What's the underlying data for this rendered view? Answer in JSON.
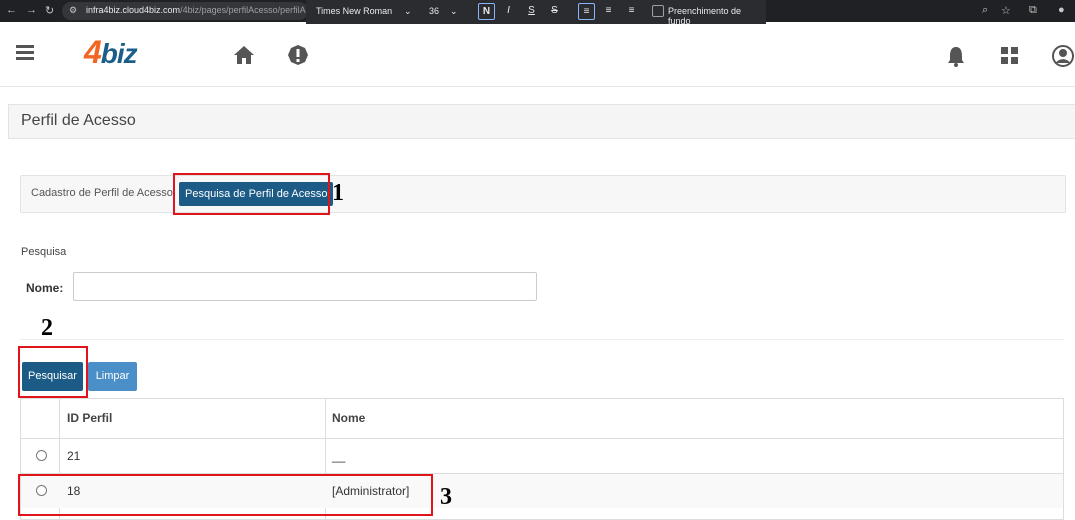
{
  "browser": {
    "url_host": "infra4biz.cloud4biz.com",
    "url_path": "/4biz/pages/perfilAcesso/perfilAcesso...",
    "format_toolbar": {
      "font": "Times New Roman",
      "size": "36",
      "bold": "N",
      "italic": "I",
      "underline": "S",
      "strike": "S",
      "background_fill_label": "Preenchimento de fundo"
    }
  },
  "app": {
    "logo_digit": "4",
    "logo_text": "biz"
  },
  "page": {
    "title": "Perfil de Acesso"
  },
  "tabs": {
    "cadastro": "Cadastro de Perfil de Acesso",
    "pesquisa": "Pesquisa de Perfil de Acesso"
  },
  "search": {
    "section_label": "Pesquisa",
    "nome_label": "Nome:",
    "nome_value": "",
    "pesquisar_label": "Pesquisar",
    "limpar_label": "Limpar"
  },
  "table": {
    "headers": [
      "ID Perfil",
      "Nome"
    ],
    "rows": [
      {
        "id": "21",
        "nome": "__"
      },
      {
        "id": "18",
        "nome": "[Administrator]"
      }
    ]
  },
  "annotations": [
    "1",
    "2",
    "3"
  ],
  "colors": {
    "primary": "#1b5b85",
    "secondary": "#4a8fc8",
    "highlight": "#e0141b",
    "logo_orange": "#f26522"
  }
}
